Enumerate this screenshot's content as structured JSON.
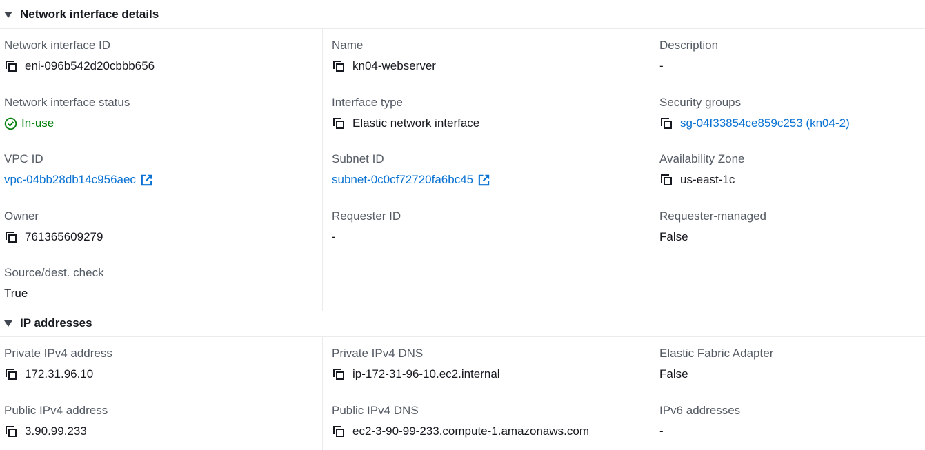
{
  "sections": {
    "details_title": "Network interface details",
    "ip_title": "IP addresses"
  },
  "details": {
    "eni_id": {
      "label": "Network interface ID",
      "value": "eni-096b542d20cbbb656"
    },
    "name": {
      "label": "Name",
      "value": "kn04-webserver"
    },
    "description": {
      "label": "Description",
      "value": "-"
    },
    "status": {
      "label": "Network interface status",
      "value": "In-use"
    },
    "interface_type": {
      "label": "Interface type",
      "value": "Elastic network interface"
    },
    "security_groups": {
      "label": "Security groups",
      "value": "sg-04f33854ce859c253 (kn04-2)"
    },
    "vpc_id": {
      "label": "VPC ID",
      "value": "vpc-04bb28db14c956aec"
    },
    "subnet_id": {
      "label": "Subnet ID",
      "value": "subnet-0c0cf72720fa6bc45"
    },
    "availability_zone": {
      "label": "Availability Zone",
      "value": "us-east-1c"
    },
    "owner": {
      "label": "Owner",
      "value": "761365609279"
    },
    "requester_id": {
      "label": "Requester ID",
      "value": "-"
    },
    "requester_managed": {
      "label": "Requester-managed",
      "value": "False"
    },
    "source_dest_check": {
      "label": "Source/dest. check",
      "value": "True"
    }
  },
  "ip": {
    "private_ipv4": {
      "label": "Private IPv4 address",
      "value": "172.31.96.10"
    },
    "private_dns": {
      "label": "Private IPv4 DNS",
      "value": "ip-172-31-96-10.ec2.internal"
    },
    "efa": {
      "label": "Elastic Fabric Adapter",
      "value": "False"
    },
    "public_ipv4": {
      "label": "Public IPv4 address",
      "value": "3.90.99.233"
    },
    "public_dns": {
      "label": "Public IPv4 DNS",
      "value": "ec2-3-90-99-233.compute-1.amazonaws.com"
    },
    "ipv6": {
      "label": "IPv6 addresses",
      "value": "-"
    }
  },
  "icons": {
    "caret": "caret-down-icon",
    "copy": "copy-icon",
    "status": "status-check-icon",
    "external": "external-link-icon"
  },
  "colors": {
    "link": "#0972d3",
    "success": "#037f0c",
    "label": "#545b64",
    "divider": "#e9ebed"
  }
}
